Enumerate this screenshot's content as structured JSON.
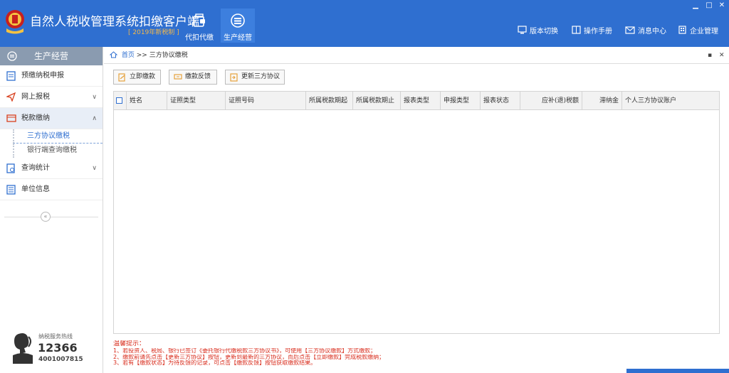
{
  "header": {
    "title": "自然人税收管理系统扣缴客户端",
    "subtitle": "[ 2019年新税制 ]",
    "nav": [
      {
        "label": "代扣代缴",
        "icon": "wallet-icon"
      },
      {
        "label": "生产经营",
        "icon": "coins-icon"
      }
    ],
    "links": [
      {
        "label": "版本切换",
        "icon": "monitor-icon"
      },
      {
        "label": "操作手册",
        "icon": "book-icon"
      },
      {
        "label": "消息中心",
        "icon": "mail-icon"
      },
      {
        "label": "企业管理",
        "icon": "building-icon"
      }
    ],
    "window_controls": {
      "minimize": "▁",
      "maximize": "□",
      "close": "✕"
    }
  },
  "sidebar": {
    "title": "生产经营",
    "items": [
      {
        "label": "预缴纳税申报",
        "icon": "report-icon",
        "chevron": ""
      },
      {
        "label": "网上报税",
        "icon": "send-icon",
        "chevron": "∨"
      },
      {
        "label": "税款缴纳",
        "icon": "payment-icon",
        "chevron": "∧"
      },
      {
        "label": "查询统计",
        "icon": "query-icon",
        "chevron": "∨"
      },
      {
        "label": "单位信息",
        "icon": "list-icon",
        "chevron": ""
      }
    ],
    "sub_items": [
      {
        "label": "三方协议缴税"
      },
      {
        "label": "银行端查询缴税"
      }
    ],
    "collapse": "«",
    "hotline": {
      "label": "纳税服务热线",
      "number": "12366",
      "sub": "4001007815"
    }
  },
  "breadcrumb": {
    "home": "首页",
    "sep": ">>",
    "current": "三方协议缴税",
    "controls": [
      "▪",
      "✕"
    ]
  },
  "toolbar": {
    "buttons": [
      {
        "label": "立即缴款"
      },
      {
        "label": "缴款反馈"
      },
      {
        "label": "更新三方协议"
      }
    ]
  },
  "table": {
    "columns": [
      "姓名",
      "证照类型",
      "证照号码",
      "所属税款期起",
      "所属税款期止",
      "报表类型",
      "申报类型",
      "报表状态",
      "应补(退)税额",
      "滞纳金",
      "个人三方协议账户"
    ],
    "rows": []
  },
  "tips": {
    "title": "温馨提示：",
    "lines": [
      "1、若投资人、税局、银行已签订《委托银行代缴税款三方协议书》，可使用【三方协议缴款】方式缴款；",
      "2、缴款前请先点击【更新三方协议】按钮，更新到最新的三方协议，而后点击【立即缴款】完成税款缴纳；",
      "3、若有【缴款状态】为待反馈的记录，可点击【缴款反馈】按钮获取缴款结果。"
    ]
  },
  "colors": {
    "header": "#2f6fd0",
    "tip_red": "#d82a1a",
    "accent_gold": "#f2b84b"
  }
}
